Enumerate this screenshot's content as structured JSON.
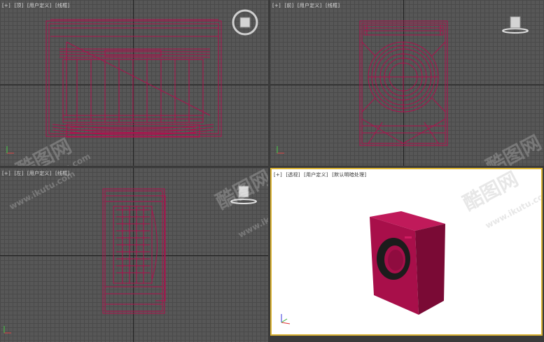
{
  "viewports": {
    "top": {
      "plus": "[+]",
      "view": "[顶]",
      "camera": "[用户定义]",
      "mode": "[线框]"
    },
    "front": {
      "plus": "[+]",
      "view": "[前]",
      "camera": "[用户定义]",
      "mode": "[线框]"
    },
    "left": {
      "plus": "[+]",
      "view": "[左]",
      "camera": "[用户定义]",
      "mode": "[线框]"
    },
    "perspective": {
      "plus": "[+]",
      "view": "[透视]",
      "camera": "[用户定义]",
      "mode": "[默认明暗处理]"
    }
  },
  "watermark": {
    "brand": "酷图网",
    "url": "www.ikutu.com"
  },
  "colors": {
    "wire": "#b0104e",
    "body": "#a80f4a",
    "body_side": "#7a0a35",
    "body_top": "#c01a5a",
    "door": "#1c1c1c",
    "grid_bg": "#575757",
    "active_border": "#d9b233"
  }
}
